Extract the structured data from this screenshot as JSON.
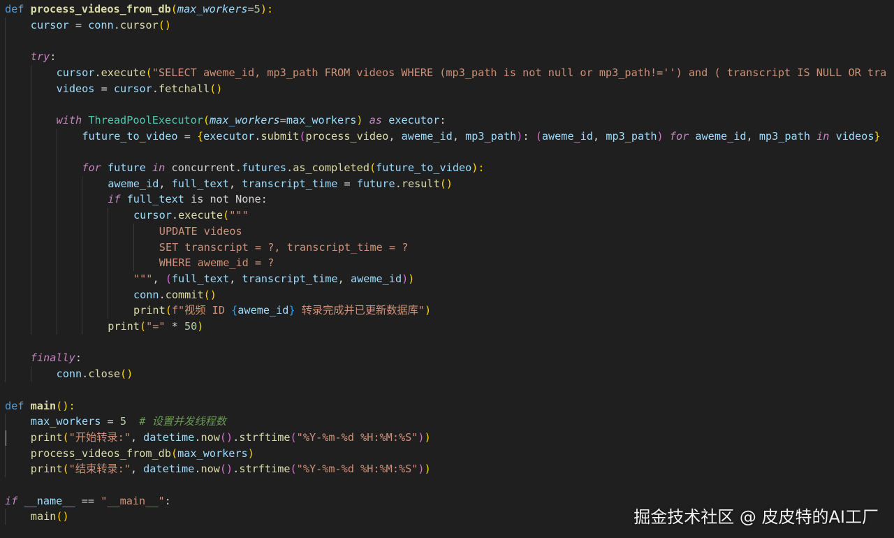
{
  "editor": {
    "language": "python",
    "theme_colors": {
      "background": "#1f1f1f",
      "keyword": "#569cd6",
      "control_keyword": "#c586c0",
      "function": "#dcdcaa",
      "variable": "#9cdcfe",
      "string": "#ce9178",
      "number": "#b5cea8",
      "class": "#4ec9b0",
      "comment": "#6a9955"
    },
    "lines": [
      {
        "indent": 0,
        "tokens": [
          {
            "t": "def",
            "c": "kw"
          },
          {
            "t": " "
          },
          {
            "t": "process_videos_from_db",
            "c": "fnb"
          },
          {
            "t": "(",
            "c": "p1"
          },
          {
            "t": "max_workers",
            "c": "param"
          },
          {
            "t": "=",
            "c": "op"
          },
          {
            "t": "5",
            "c": "num"
          },
          {
            "t": "):",
            "c": "p1"
          }
        ]
      },
      {
        "indent": 1,
        "tokens": [
          {
            "t": "cursor",
            "c": "var"
          },
          {
            "t": " = "
          },
          {
            "t": "conn",
            "c": "var"
          },
          {
            "t": "."
          },
          {
            "t": "cursor",
            "c": "fn"
          },
          {
            "t": "()",
            "c": "p1"
          }
        ]
      },
      {
        "indent": 0,
        "tokens": []
      },
      {
        "indent": 1,
        "tokens": [
          {
            "t": "try",
            "c": "kwc"
          },
          {
            "t": ":"
          }
        ]
      },
      {
        "indent": 2,
        "tokens": [
          {
            "t": "cursor",
            "c": "var"
          },
          {
            "t": "."
          },
          {
            "t": "execute",
            "c": "fn"
          },
          {
            "t": "(",
            "c": "p1"
          },
          {
            "t": "\"SELECT aweme_id, mp3_path FROM videos WHERE (mp3_path is not null or mp3_path!='') and ( transcript IS NULL OR tra",
            "c": "str"
          }
        ]
      },
      {
        "indent": 2,
        "tokens": [
          {
            "t": "videos",
            "c": "var"
          },
          {
            "t": " = "
          },
          {
            "t": "cursor",
            "c": "var"
          },
          {
            "t": "."
          },
          {
            "t": "fetchall",
            "c": "fn"
          },
          {
            "t": "()",
            "c": "p1"
          }
        ]
      },
      {
        "indent": 0,
        "tokens": []
      },
      {
        "indent": 2,
        "tokens": [
          {
            "t": "with",
            "c": "kwc"
          },
          {
            "t": " "
          },
          {
            "t": "ThreadPoolExecutor",
            "c": "cls"
          },
          {
            "t": "(",
            "c": "p1"
          },
          {
            "t": "max_workers",
            "c": "param"
          },
          {
            "t": "="
          },
          {
            "t": "max_workers",
            "c": "var"
          },
          {
            "t": ")",
            "c": "p1"
          },
          {
            "t": " "
          },
          {
            "t": "as",
            "c": "kwc"
          },
          {
            "t": " "
          },
          {
            "t": "executor",
            "c": "var"
          },
          {
            "t": ":"
          }
        ]
      },
      {
        "indent": 3,
        "tokens": [
          {
            "t": "future_to_video",
            "c": "var"
          },
          {
            "t": " = "
          },
          {
            "t": "{",
            "c": "p1"
          },
          {
            "t": "executor",
            "c": "var"
          },
          {
            "t": "."
          },
          {
            "t": "submit",
            "c": "fn"
          },
          {
            "t": "(",
            "c": "p2"
          },
          {
            "t": "process_video",
            "c": "fn"
          },
          {
            "t": ", "
          },
          {
            "t": "aweme_id",
            "c": "var"
          },
          {
            "t": ", "
          },
          {
            "t": "mp3_path",
            "c": "var"
          },
          {
            "t": ")",
            "c": "p2"
          },
          {
            "t": ": "
          },
          {
            "t": "(",
            "c": "p2"
          },
          {
            "t": "aweme_id",
            "c": "var"
          },
          {
            "t": ", "
          },
          {
            "t": "mp3_path",
            "c": "var"
          },
          {
            "t": ")",
            "c": "p2"
          },
          {
            "t": " "
          },
          {
            "t": "for",
            "c": "kwc"
          },
          {
            "t": " "
          },
          {
            "t": "aweme_id",
            "c": "var"
          },
          {
            "t": ", "
          },
          {
            "t": "mp3_path",
            "c": "var"
          },
          {
            "t": " "
          },
          {
            "t": "in",
            "c": "kwc"
          },
          {
            "t": " "
          },
          {
            "t": "videos",
            "c": "var"
          },
          {
            "t": "}",
            "c": "p1"
          }
        ]
      },
      {
        "indent": 0,
        "tokens": []
      },
      {
        "indent": 3,
        "tokens": [
          {
            "t": "for",
            "c": "kwc"
          },
          {
            "t": " "
          },
          {
            "t": "future",
            "c": "var"
          },
          {
            "t": " "
          },
          {
            "t": "in",
            "c": "kwc"
          },
          {
            "t": " "
          },
          {
            "t": "concurrent",
            "c": "nm"
          },
          {
            "t": "."
          },
          {
            "t": "futures",
            "c": "var"
          },
          {
            "t": "."
          },
          {
            "t": "as_completed",
            "c": "fn"
          },
          {
            "t": "(",
            "c": "p1"
          },
          {
            "t": "future_to_video",
            "c": "var"
          },
          {
            "t": "):",
            "c": "p1"
          }
        ]
      },
      {
        "indent": 4,
        "tokens": [
          {
            "t": "aweme_id",
            "c": "var"
          },
          {
            "t": ", "
          },
          {
            "t": "full_text",
            "c": "var"
          },
          {
            "t": ", "
          },
          {
            "t": "transcript_time",
            "c": "var"
          },
          {
            "t": " = "
          },
          {
            "t": "future",
            "c": "var"
          },
          {
            "t": "."
          },
          {
            "t": "result",
            "c": "fn"
          },
          {
            "t": "()",
            "c": "p1"
          }
        ]
      },
      {
        "indent": 4,
        "tokens": [
          {
            "t": "if",
            "c": "kwc"
          },
          {
            "t": " "
          },
          {
            "t": "full_text",
            "c": "var"
          },
          {
            "t": " is not "
          },
          {
            "t": "None",
            "c": "nm"
          },
          {
            "t": ":"
          }
        ]
      },
      {
        "indent": 5,
        "tokens": [
          {
            "t": "cursor",
            "c": "var"
          },
          {
            "t": "."
          },
          {
            "t": "execute",
            "c": "fn"
          },
          {
            "t": "(",
            "c": "p1"
          },
          {
            "t": "\"\"\"",
            "c": "str"
          }
        ]
      },
      {
        "indent": 6,
        "tokens": [
          {
            "t": "UPDATE videos",
            "c": "str"
          }
        ]
      },
      {
        "indent": 6,
        "tokens": [
          {
            "t": "SET transcript = ?, transcript_time = ?",
            "c": "str"
          }
        ]
      },
      {
        "indent": 6,
        "tokens": [
          {
            "t": "WHERE aweme_id = ?",
            "c": "str"
          }
        ]
      },
      {
        "indent": 5,
        "tokens": [
          {
            "t": "\"\"\"",
            "c": "str"
          },
          {
            "t": ", "
          },
          {
            "t": "(",
            "c": "p2"
          },
          {
            "t": "full_text",
            "c": "var"
          },
          {
            "t": ", "
          },
          {
            "t": "transcript_time",
            "c": "var"
          },
          {
            "t": ", "
          },
          {
            "t": "aweme_id",
            "c": "var"
          },
          {
            "t": ")",
            "c": "p2"
          },
          {
            "t": ")",
            "c": "p1"
          }
        ]
      },
      {
        "indent": 5,
        "tokens": [
          {
            "t": "conn",
            "c": "var"
          },
          {
            "t": "."
          },
          {
            "t": "commit",
            "c": "fn"
          },
          {
            "t": "()",
            "c": "p1"
          }
        ]
      },
      {
        "indent": 5,
        "tokens": [
          {
            "t": "print",
            "c": "fn"
          },
          {
            "t": "(",
            "c": "p1"
          },
          {
            "t": "f\"视频 ID ",
            "c": "str"
          },
          {
            "t": "{",
            "c": "p3"
          },
          {
            "t": "aweme_id",
            "c": "var"
          },
          {
            "t": "}",
            "c": "p3"
          },
          {
            "t": " 转录完成并已更新数据库\"",
            "c": "str"
          },
          {
            "t": ")",
            "c": "p1"
          }
        ]
      },
      {
        "indent": 4,
        "tokens": [
          {
            "t": "print",
            "c": "fn"
          },
          {
            "t": "(",
            "c": "p1"
          },
          {
            "t": "\"=\"",
            "c": "str"
          },
          {
            "t": " * "
          },
          {
            "t": "50",
            "c": "num"
          },
          {
            "t": ")",
            "c": "p1"
          }
        ]
      },
      {
        "indent": 0,
        "tokens": []
      },
      {
        "indent": 1,
        "tokens": [
          {
            "t": "finally",
            "c": "kwc"
          },
          {
            "t": ":"
          }
        ]
      },
      {
        "indent": 2,
        "tokens": [
          {
            "t": "conn",
            "c": "var"
          },
          {
            "t": "."
          },
          {
            "t": "close",
            "c": "fn"
          },
          {
            "t": "()",
            "c": "p1"
          }
        ]
      },
      {
        "indent": 0,
        "tokens": []
      },
      {
        "indent": 0,
        "tokens": [
          {
            "t": "def",
            "c": "kw"
          },
          {
            "t": " "
          },
          {
            "t": "main",
            "c": "fnb"
          },
          {
            "t": "():",
            "c": "p1"
          }
        ]
      },
      {
        "indent": 1,
        "tokens": [
          {
            "t": "max_workers",
            "c": "var"
          },
          {
            "t": " = "
          },
          {
            "t": "5",
            "c": "num"
          },
          {
            "t": "  "
          },
          {
            "t": "# 设置并发线程数",
            "c": "cm"
          }
        ]
      },
      {
        "indent": 1,
        "tokens": [
          {
            "t": "print",
            "c": "fn"
          },
          {
            "t": "(",
            "c": "p1"
          },
          {
            "t": "\"开始转录:\"",
            "c": "str"
          },
          {
            "t": ", "
          },
          {
            "t": "datetime",
            "c": "var"
          },
          {
            "t": "."
          },
          {
            "t": "now",
            "c": "fn"
          },
          {
            "t": "()",
            "c": "p2"
          },
          {
            "t": "."
          },
          {
            "t": "strftime",
            "c": "fn"
          },
          {
            "t": "(",
            "c": "p2"
          },
          {
            "t": "\"%Y-%m-%d %H:%M:%S\"",
            "c": "str"
          },
          {
            "t": ")",
            "c": "p2"
          },
          {
            "t": ")",
            "c": "p1"
          }
        ]
      },
      {
        "indent": 1,
        "tokens": [
          {
            "t": "process_videos_from_db",
            "c": "fn"
          },
          {
            "t": "(",
            "c": "p1"
          },
          {
            "t": "max_workers",
            "c": "var"
          },
          {
            "t": ")",
            "c": "p1"
          }
        ]
      },
      {
        "indent": 1,
        "tokens": [
          {
            "t": "print",
            "c": "fn"
          },
          {
            "t": "(",
            "c": "p1"
          },
          {
            "t": "\"结束转录:\"",
            "c": "str"
          },
          {
            "t": ", "
          },
          {
            "t": "datetime",
            "c": "var"
          },
          {
            "t": "."
          },
          {
            "t": "now",
            "c": "fn"
          },
          {
            "t": "()",
            "c": "p2"
          },
          {
            "t": "."
          },
          {
            "t": "strftime",
            "c": "fn"
          },
          {
            "t": "(",
            "c": "p2"
          },
          {
            "t": "\"%Y-%m-%d %H:%M:%S\"",
            "c": "str"
          },
          {
            "t": ")",
            "c": "p2"
          },
          {
            "t": ")",
            "c": "p1"
          }
        ]
      },
      {
        "indent": 0,
        "tokens": []
      },
      {
        "indent": 0,
        "tokens": [
          {
            "t": "if",
            "c": "kwc"
          },
          {
            "t": " "
          },
          {
            "t": "__name__",
            "c": "var"
          },
          {
            "t": " == "
          },
          {
            "t": "\"__main__\"",
            "c": "str"
          },
          {
            "t": ":"
          }
        ]
      },
      {
        "indent": 1,
        "tokens": [
          {
            "t": "main",
            "c": "fn"
          },
          {
            "t": "()",
            "c": "p1"
          }
        ]
      }
    ]
  },
  "watermark": {
    "text": "掘金技术社区 @ 皮皮特的AI工厂"
  }
}
